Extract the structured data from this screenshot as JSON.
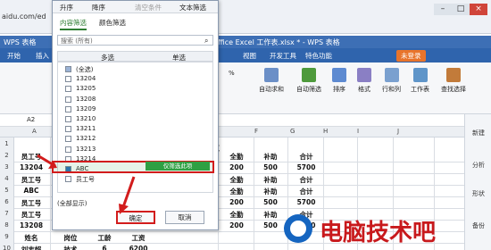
{
  "browser": {
    "url": "aidu.com/ed"
  },
  "window": {
    "app_name": "WPS 表格",
    "title": "ffice Excel 工作表.xlsx * - WPS 表格",
    "unlogged": "未登录"
  },
  "menu": [
    "开始",
    "插入",
    "视图",
    "开发工具",
    "特色功能"
  ],
  "ribbon": {
    "autosum": "自动求和",
    "autofilter": "自动筛选",
    "sort": "排序",
    "format": "格式",
    "rowcol": "行和列",
    "sheet": "工作表",
    "find": "查找选择",
    "percent": "%"
  },
  "formula_bar": {
    "cell_ref": "A2"
  },
  "columns": [
    "A",
    "B",
    "C",
    "D",
    "E",
    "F",
    "G",
    "H",
    "I",
    "J"
  ],
  "rows": [
    "1",
    "2",
    "3",
    "4",
    "5",
    "6",
    "7",
    "8",
    "9",
    "10"
  ],
  "sheet": {
    "title_fragment": "表",
    "cells": [
      [
        "员工号",
        "",
        "",
        "",
        "全勤",
        "补助",
        "合计"
      ],
      [
        "13204",
        "",
        "",
        "",
        "200",
        "500",
        "5700"
      ],
      [
        "员工号",
        "",
        "",
        "",
        "全勤",
        "补助",
        "合计"
      ],
      [
        "ABC",
        "",
        "",
        "",
        "全勤",
        "补助",
        "合计"
      ],
      [
        "员工号",
        "",
        "",
        "",
        "200",
        "500",
        "5700"
      ],
      [
        "员工号",
        "",
        "",
        "",
        "全勤",
        "补助",
        "合计"
      ],
      [
        "13208",
        "",
        "",
        "",
        "200",
        "500",
        "5700"
      ],
      [
        "姓名",
        "岗位",
        "工龄",
        "工资",
        "",
        "",
        ""
      ],
      [
        "刘志超",
        "技术",
        "6",
        "6200",
        "",
        "",
        ""
      ]
    ]
  },
  "side_panel": [
    "新建",
    "分析",
    "形状",
    "备份"
  ],
  "dialog": {
    "toolbar": [
      "升序",
      "降序",
      "清空条件",
      "文本筛选"
    ],
    "tabs": [
      "内容筛选",
      "颜色筛选"
    ],
    "search_placeholder": "搜索 (所有)",
    "list_headers": [
      "多选",
      "单选"
    ],
    "items": [
      {
        "label": "(全选)",
        "checked": false,
        "partial": true
      },
      {
        "label": "13204",
        "checked": false
      },
      {
        "label": "13205",
        "checked": false
      },
      {
        "label": "13208",
        "checked": false
      },
      {
        "label": "13209",
        "checked": false
      },
      {
        "label": "13210",
        "checked": false
      },
      {
        "label": "13211",
        "checked": false
      },
      {
        "label": "13212",
        "checked": false
      },
      {
        "label": "13213",
        "checked": false
      },
      {
        "label": "13214",
        "checked": false
      },
      {
        "label": "ABC",
        "checked": true
      },
      {
        "label": "员工号",
        "checked": false
      }
    ],
    "annotation": "仅筛选此项",
    "show_all": "(全部显示)",
    "ok": "确定",
    "cancel": "取消"
  },
  "watermark": "电脑技术吧"
}
